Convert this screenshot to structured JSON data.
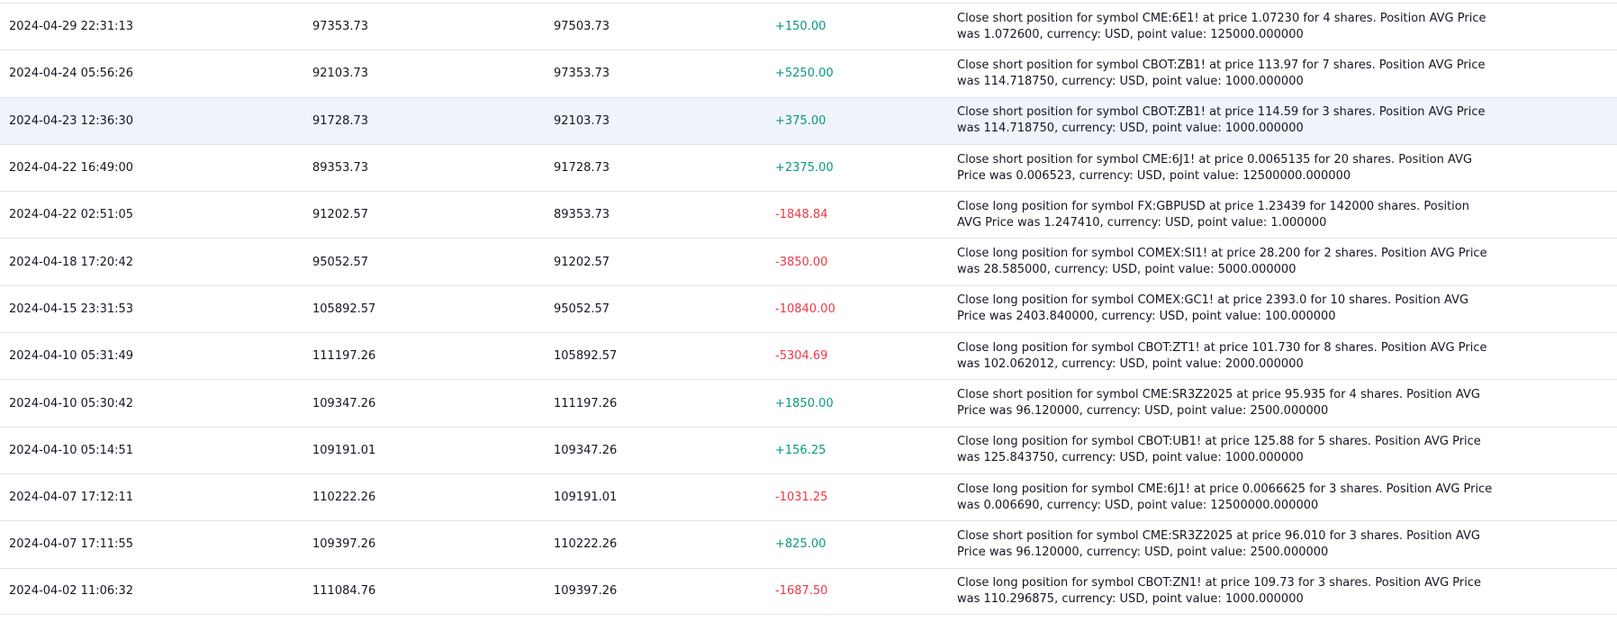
{
  "colors": {
    "positive": "#089981",
    "negative": "#f23645",
    "row_highlight": "#f0f3fa",
    "divider": "#e0e3eb"
  },
  "rows": [
    {
      "date": "2024-04-29 22:31:13",
      "balance_before": "97353.73",
      "balance_after": "97503.73",
      "pnl": "+150.00",
      "pnl_sign": "positive",
      "description": "Close short position for symbol CME:6E1! at price 1.07230 for 4 shares. Position AVG Price was 1.072600, currency: USD, point value: 125000.000000"
    },
    {
      "date": "2024-04-24 05:56:26",
      "balance_before": "92103.73",
      "balance_after": "97353.73",
      "pnl": "+5250.00",
      "pnl_sign": "positive",
      "description": "Close short position for symbol CBOT:ZB1! at price 113.97 for 7 shares. Position AVG Price was 114.718750, currency: USD, point value: 1000.000000"
    },
    {
      "date": "2024-04-23 12:36:30",
      "balance_before": "91728.73",
      "balance_after": "92103.73",
      "pnl": "+375.00",
      "pnl_sign": "positive",
      "highlight": true,
      "description": "Close short position for symbol CBOT:ZB1! at price 114.59 for 3 shares. Position AVG Price was 114.718750, currency: USD, point value: 1000.000000"
    },
    {
      "date": "2024-04-22 16:49:00",
      "balance_before": "89353.73",
      "balance_after": "91728.73",
      "pnl": "+2375.00",
      "pnl_sign": "positive",
      "description": "Close short position for symbol CME:6J1! at price 0.0065135 for 20 shares. Position AVG Price was 0.006523, currency: USD, point value: 12500000.000000"
    },
    {
      "date": "2024-04-22 02:51:05",
      "balance_before": "91202.57",
      "balance_after": "89353.73",
      "pnl": "-1848.84",
      "pnl_sign": "negative",
      "description": "Close long position for symbol FX:GBPUSD at price 1.23439 for 142000 shares. Position AVG Price was 1.247410, currency: USD, point value: 1.000000"
    },
    {
      "date": "2024-04-18 17:20:42",
      "balance_before": "95052.57",
      "balance_after": "91202.57",
      "pnl": "-3850.00",
      "pnl_sign": "negative",
      "description": "Close long position for symbol COMEX:SI1! at price 28.200 for 2 shares. Position AVG Price was 28.585000, currency: USD, point value: 5000.000000"
    },
    {
      "date": "2024-04-15 23:31:53",
      "balance_before": "105892.57",
      "balance_after": "95052.57",
      "pnl": "-10840.00",
      "pnl_sign": "negative",
      "description": "Close long position for symbol COMEX:GC1! at price 2393.0 for 10 shares. Position AVG Price was 2403.840000, currency: USD, point value: 100.000000"
    },
    {
      "date": "2024-04-10 05:31:49",
      "balance_before": "111197.26",
      "balance_after": "105892.57",
      "pnl": "-5304.69",
      "pnl_sign": "negative",
      "description": "Close long position for symbol CBOT:ZT1! at price 101.730 for 8 shares. Position AVG Price was 102.062012, currency: USD, point value: 2000.000000"
    },
    {
      "date": "2024-04-10 05:30:42",
      "balance_before": "109347.26",
      "balance_after": "111197.26",
      "pnl": "+1850.00",
      "pnl_sign": "positive",
      "description": "Close short position for symbol CME:SR3Z2025 at price 95.935 for 4 shares. Position AVG Price was 96.120000, currency: USD, point value: 2500.000000"
    },
    {
      "date": "2024-04-10 05:14:51",
      "balance_before": "109191.01",
      "balance_after": "109347.26",
      "pnl": "+156.25",
      "pnl_sign": "positive",
      "description": "Close long position for symbol CBOT:UB1! at price 125.88 for 5 shares. Position AVG Price was 125.843750, currency: USD, point value: 1000.000000"
    },
    {
      "date": "2024-04-07 17:12:11",
      "balance_before": "110222.26",
      "balance_after": "109191.01",
      "pnl": "-1031.25",
      "pnl_sign": "negative",
      "description": "Close long position for symbol CME:6J1! at price 0.0066625 for 3 shares. Position AVG Price was 0.006690, currency: USD, point value: 12500000.000000"
    },
    {
      "date": "2024-04-07 17:11:55",
      "balance_before": "109397.26",
      "balance_after": "110222.26",
      "pnl": "+825.00",
      "pnl_sign": "positive",
      "description": "Close short position for symbol CME:SR3Z2025 at price 96.010 for 3 shares. Position AVG Price was 96.120000, currency: USD, point value: 2500.000000"
    },
    {
      "date": "2024-04-02 11:06:32",
      "balance_before": "111084.76",
      "balance_after": "109397.26",
      "pnl": "-1687.50",
      "pnl_sign": "negative",
      "description": "Close long position for symbol CBOT:ZN1! at price 109.73 for 3 shares. Position AVG Price was 110.296875, currency: USD, point value: 1000.000000"
    }
  ]
}
